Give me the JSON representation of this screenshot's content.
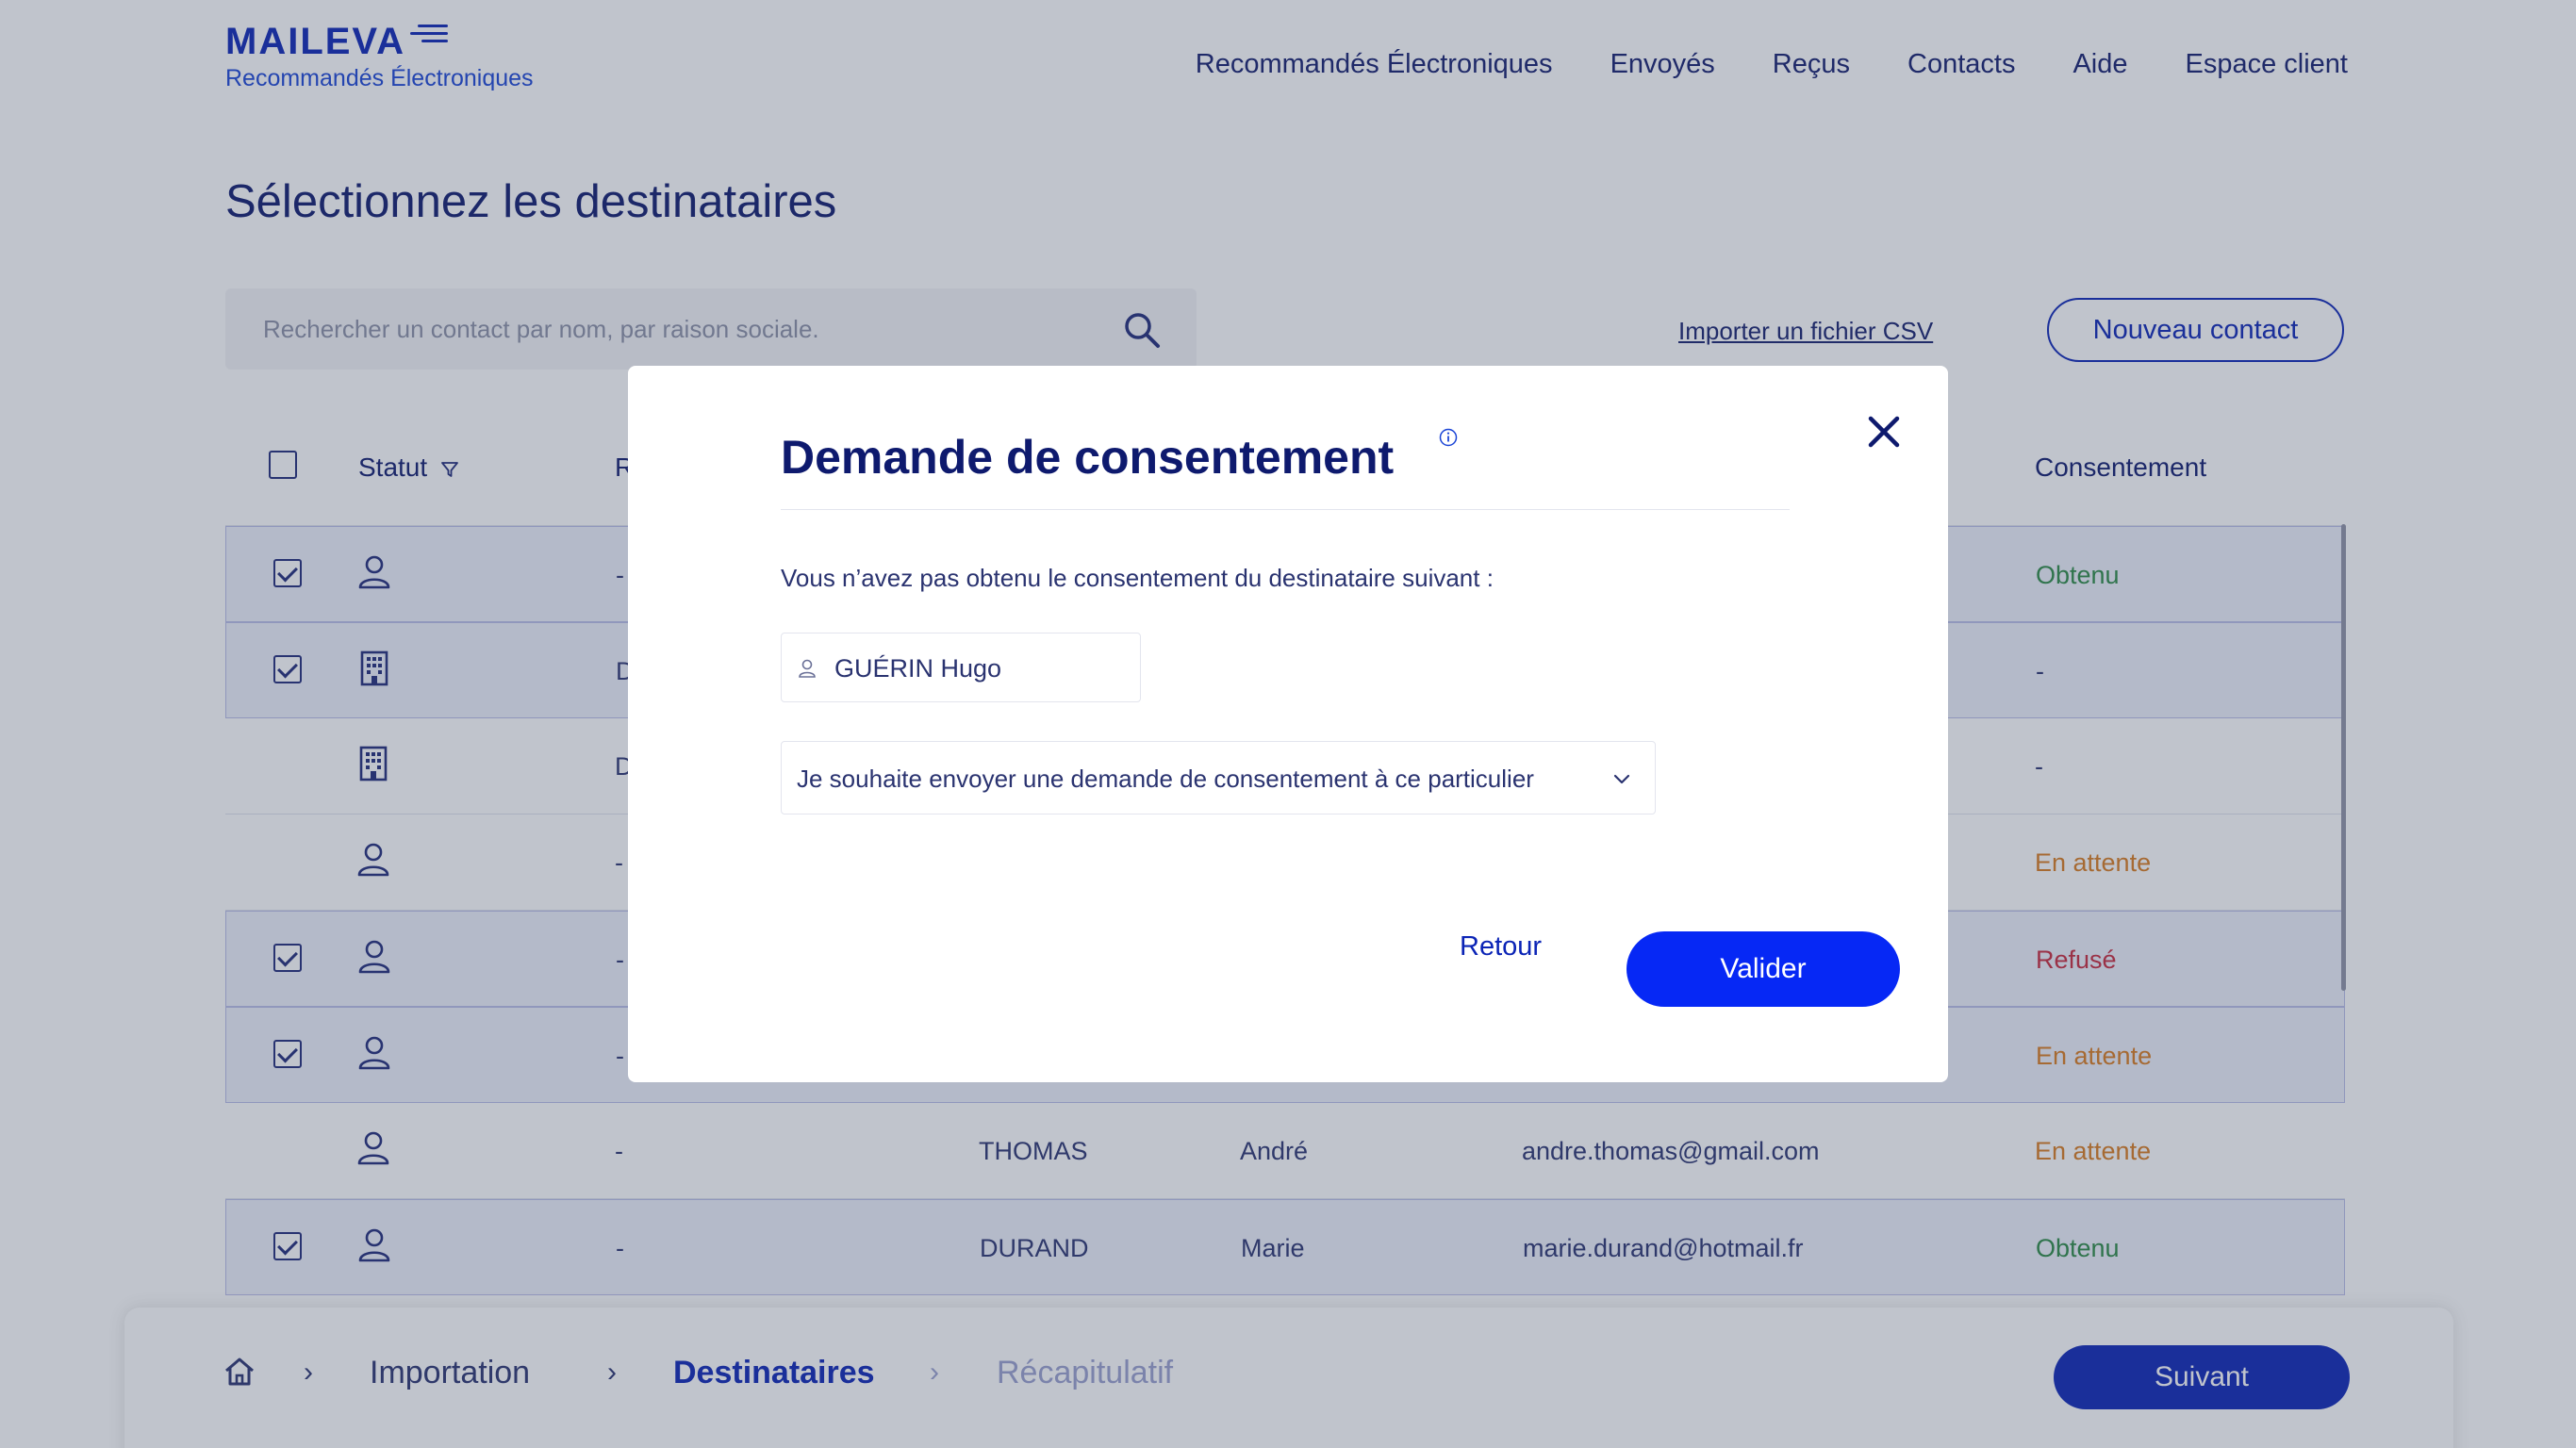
{
  "brand": {
    "name": "MAILEVA",
    "subtitle": "Recommandés Électroniques"
  },
  "nav": {
    "items": [
      {
        "label": "Recommandés Électroniques"
      },
      {
        "label": "Envoyés"
      },
      {
        "label": "Reçus"
      },
      {
        "label": "Contacts"
      },
      {
        "label": "Aide"
      },
      {
        "label": "Espace client"
      }
    ]
  },
  "page": {
    "title": "Sélectionnez les destinataires"
  },
  "toolbar": {
    "search_placeholder": "Rechercher un contact par nom, par raison sociale.",
    "import_csv_label": "Importer un fichier CSV",
    "new_contact_label": "Nouveau contact"
  },
  "table": {
    "headers": {
      "status": "Statut",
      "company_initial": "R",
      "consent": "Consentement"
    },
    "rows": [
      {
        "checked": true,
        "type": "person",
        "company": "-",
        "last_name": "",
        "first_name": "",
        "email": "",
        "consent": "Obtenu",
        "consent_state": "ok"
      },
      {
        "checked": true,
        "type": "company",
        "company": "D",
        "last_name": "",
        "first_name": "",
        "email": "",
        "consent": "-",
        "consent_state": "none"
      },
      {
        "checked": false,
        "type": "company",
        "company": "D",
        "last_name": "",
        "first_name": "",
        "email": "",
        "consent": "-",
        "consent_state": "none"
      },
      {
        "checked": false,
        "type": "person",
        "company": "-",
        "last_name": "",
        "first_name": "",
        "email": "",
        "consent": "En attente",
        "consent_state": "wait"
      },
      {
        "checked": true,
        "type": "person",
        "company": "-",
        "last_name": "",
        "first_name": "",
        "email": "",
        "consent": "Refusé",
        "consent_state": "no"
      },
      {
        "checked": true,
        "type": "person",
        "company": "-",
        "last_name": "",
        "first_name": "",
        "email": "",
        "consent": "En attente",
        "consent_state": "wait"
      },
      {
        "checked": false,
        "type": "person",
        "company": "-",
        "last_name": "THOMAS",
        "first_name": "André",
        "email": "andre.thomas@gmail.com",
        "consent": "En attente",
        "consent_state": "wait"
      },
      {
        "checked": true,
        "type": "person",
        "company": "-",
        "last_name": "DURAND",
        "first_name": "Marie",
        "email": "marie.durand@hotmail.fr",
        "consent": "Obtenu",
        "consent_state": "ok"
      }
    ]
  },
  "breadcrumb": {
    "step1": "Importation",
    "step2": "Destinataires",
    "step3": "Récapitulatif",
    "next_label": "Suivant"
  },
  "modal": {
    "title": "Demande de consentement",
    "message": "Vous n’avez pas obtenu le consentement du destinataire suivant :",
    "recipient": "GUÉRIN Hugo",
    "select_value": "Je souhaite envoyer une demande de consentement à ce particulier",
    "back_label": "Retour",
    "validate_label": "Valider"
  },
  "colors": {
    "brand_blue": "#0b24b6",
    "primary_button": "#0628f5",
    "consent_ok": "#2b8a44",
    "consent_wait": "#d97b1e",
    "consent_refused": "#c8283c"
  }
}
